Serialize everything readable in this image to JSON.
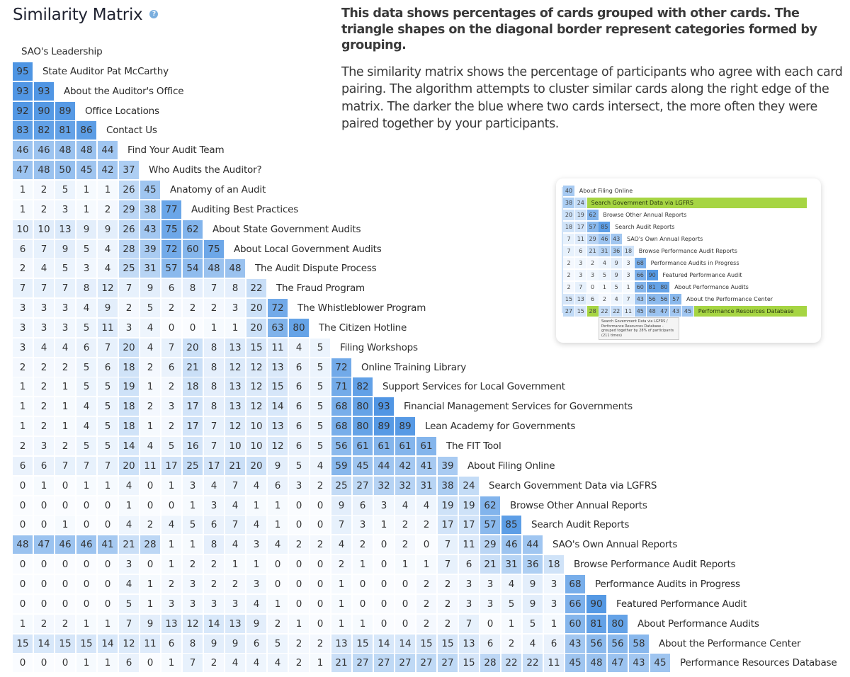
{
  "header": {
    "title": "Similarity Matrix",
    "help_icon": "question-circle-icon",
    "help_glyph": "?"
  },
  "description": {
    "lead": "This data shows percentages of cards grouped with other cards. The triangle shapes on the diagonal border represent categories formed by grouping.",
    "body": "The similarity matrix shows the percentage of participants who agree with each card pairing. The algorithm attempts to cluster similar cards along the right edge of the matrix. The darker the blue where two cards intersect, the more often they were paired together by your participants."
  },
  "colors": {
    "cell_blue_dark": "#4a90e2",
    "cell_blue_light": "#eaf3fd",
    "highlight_green": "#a6d543"
  },
  "chart_data": {
    "type": "heatmap",
    "title": "Similarity Matrix",
    "unit": "percent of participants",
    "range": [
      0,
      100
    ],
    "cards": [
      "SAO's Leadership",
      "State Auditor Pat McCarthy",
      "About the Auditor's Office",
      "Office Locations",
      "Contact Us",
      "Find Your Audit Team",
      "Who Audits the Auditor?",
      "Anatomy of an Audit",
      "Auditing Best Practices",
      "About State Government Audits",
      "About Local Government Audits",
      "The Audit Dispute Process",
      "The Fraud Program",
      "The Whistleblower Program",
      "The Citizen Hotline",
      "Filing Workshops",
      "Online Training Library",
      "Support Services for Local Government",
      "Financial Management Services for Governments",
      "Lean Academy for Governments",
      "The FIT Tool",
      "About Filing Online",
      "Search Government Data via LGFRS",
      "Browse Other Annual Reports",
      "Search Audit Reports",
      "SAO's Own Annual Reports",
      "Browse Performance Audit Reports",
      "Performance Audits in Progress",
      "Featured Performance Audit",
      "About Performance Audits",
      "About the Performance Center",
      "Performance Resources Database"
    ],
    "clusters": [
      [
        0,
        4
      ],
      [
        5,
        6
      ],
      [
        7,
        11
      ],
      [
        12,
        14
      ],
      [
        15,
        20
      ],
      [
        21,
        26
      ],
      [
        27,
        31
      ]
    ],
    "rows": [
      [],
      [
        95
      ],
      [
        93,
        93
      ],
      [
        92,
        90,
        89
      ],
      [
        83,
        82,
        81,
        86
      ],
      [
        46,
        46,
        48,
        48,
        44
      ],
      [
        47,
        48,
        50,
        45,
        42,
        37
      ],
      [
        1,
        2,
        5,
        1,
        1,
        26,
        45
      ],
      [
        1,
        2,
        3,
        1,
        2,
        29,
        38,
        77
      ],
      [
        10,
        10,
        13,
        9,
        9,
        26,
        43,
        75,
        62
      ],
      [
        6,
        7,
        9,
        5,
        4,
        28,
        39,
        72,
        60,
        75
      ],
      [
        2,
        4,
        5,
        3,
        4,
        25,
        31,
        57,
        54,
        48,
        48
      ],
      [
        7,
        7,
        7,
        8,
        12,
        7,
        9,
        6,
        8,
        7,
        8,
        22
      ],
      [
        3,
        3,
        3,
        4,
        9,
        2,
        5,
        2,
        2,
        2,
        3,
        20,
        72
      ],
      [
        3,
        3,
        3,
        5,
        11,
        3,
        4,
        0,
        0,
        1,
        1,
        20,
        63,
        80
      ],
      [
        3,
        4,
        4,
        6,
        7,
        20,
        4,
        7,
        20,
        8,
        13,
        15,
        11,
        4,
        5
      ],
      [
        2,
        2,
        2,
        5,
        6,
        18,
        2,
        6,
        21,
        8,
        12,
        12,
        13,
        6,
        5,
        72
      ],
      [
        1,
        2,
        1,
        5,
        5,
        19,
        1,
        2,
        18,
        8,
        13,
        12,
        15,
        6,
        5,
        71,
        82
      ],
      [
        1,
        2,
        1,
        4,
        5,
        18,
        2,
        3,
        17,
        8,
        13,
        12,
        14,
        6,
        5,
        68,
        80,
        93
      ],
      [
        1,
        2,
        1,
        4,
        5,
        18,
        1,
        2,
        17,
        7,
        12,
        10,
        13,
        6,
        5,
        68,
        80,
        89,
        89
      ],
      [
        2,
        3,
        2,
        5,
        5,
        14,
        4,
        5,
        16,
        7,
        10,
        10,
        12,
        6,
        5,
        56,
        61,
        61,
        61,
        61
      ],
      [
        6,
        6,
        7,
        7,
        7,
        20,
        11,
        17,
        25,
        17,
        21,
        20,
        9,
        5,
        4,
        59,
        45,
        44,
        42,
        41,
        39
      ],
      [
        0,
        1,
        0,
        1,
        1,
        4,
        0,
        1,
        3,
        4,
        7,
        4,
        6,
        3,
        2,
        25,
        27,
        32,
        32,
        31,
        38,
        24
      ],
      [
        0,
        0,
        0,
        0,
        0,
        1,
        0,
        0,
        1,
        3,
        4,
        1,
        1,
        0,
        0,
        9,
        6,
        3,
        4,
        4,
        19,
        19,
        62
      ],
      [
        0,
        0,
        1,
        0,
        0,
        4,
        2,
        4,
        5,
        6,
        7,
        4,
        1,
        0,
        0,
        7,
        3,
        1,
        2,
        2,
        17,
        17,
        57,
        85
      ],
      [
        48,
        47,
        46,
        46,
        41,
        21,
        28,
        1,
        1,
        8,
        4,
        3,
        4,
        2,
        2,
        4,
        2,
        0,
        2,
        0,
        7,
        11,
        29,
        46,
        44
      ],
      [
        0,
        0,
        0,
        0,
        0,
        3,
        0,
        1,
        2,
        2,
        1,
        1,
        0,
        0,
        0,
        2,
        1,
        0,
        1,
        1,
        7,
        6,
        21,
        31,
        36,
        18
      ],
      [
        0,
        0,
        0,
        0,
        0,
        4,
        1,
        2,
        3,
        2,
        2,
        3,
        0,
        0,
        0,
        1,
        0,
        0,
        0,
        2,
        2,
        3,
        3,
        4,
        9,
        3,
        68
      ],
      [
        0,
        0,
        0,
        0,
        0,
        5,
        1,
        3,
        3,
        3,
        3,
        4,
        1,
        0,
        0,
        1,
        0,
        0,
        0,
        2,
        2,
        3,
        3,
        5,
        9,
        3,
        66,
        90
      ],
      [
        1,
        2,
        2,
        1,
        1,
        7,
        9,
        13,
        12,
        14,
        13,
        9,
        2,
        1,
        0,
        1,
        1,
        0,
        0,
        2,
        2,
        7,
        0,
        1,
        5,
        1,
        60,
        81,
        80
      ],
      [
        15,
        14,
        15,
        15,
        14,
        12,
        11,
        6,
        8,
        9,
        9,
        6,
        5,
        2,
        2,
        13,
        15,
        14,
        14,
        15,
        15,
        13,
        6,
        2,
        4,
        6,
        43,
        56,
        56,
        58
      ],
      [
        0,
        0,
        0,
        1,
        1,
        6,
        0,
        1,
        7,
        2,
        4,
        4,
        4,
        2,
        1,
        21,
        27,
        27,
        27,
        27,
        27,
        15,
        28,
        22,
        22,
        11,
        45,
        48,
        47,
        43,
        45
      ]
    ]
  },
  "inset": {
    "rows": [
      {
        "label": "About Filing Online",
        "values": [
          40
        ],
        "highlight": false
      },
      {
        "label": "Search Government Data via LGFRS",
        "values": [
          38,
          24
        ],
        "highlight": true
      },
      {
        "label": "Browse Other Annual Reports",
        "values": [
          20,
          19,
          62
        ],
        "highlight": false
      },
      {
        "label": "Search Audit Reports",
        "values": [
          18,
          17,
          57,
          85
        ],
        "highlight": false
      },
      {
        "label": "SAO's Own Annual Reports",
        "values": [
          7,
          11,
          29,
          46,
          43
        ],
        "highlight": false
      },
      {
        "label": "Browse Performance Audit Reports",
        "values": [
          7,
          6,
          21,
          31,
          36,
          18
        ],
        "highlight": false
      },
      {
        "label": "Performance Audits in Progress",
        "values": [
          2,
          3,
          2,
          4,
          9,
          3,
          68
        ],
        "highlight": false
      },
      {
        "label": "Featured Performance Audit",
        "values": [
          2,
          3,
          3,
          5,
          9,
          3,
          66,
          90
        ],
        "highlight": false
      },
      {
        "label": "About Performance Audits",
        "values": [
          2,
          7,
          0,
          1,
          5,
          1,
          60,
          81,
          80
        ],
        "highlight": false
      },
      {
        "label": "About the Performance Center",
        "values": [
          15,
          13,
          6,
          2,
          4,
          7,
          43,
          56,
          56,
          57
        ],
        "highlight": false
      },
      {
        "label": "Performance Resources Database",
        "values": [
          27,
          15,
          28,
          22,
          22,
          11,
          45,
          48,
          47,
          43,
          45
        ],
        "highlight": true,
        "highlight_cell": 2
      }
    ],
    "tooltip": "Search Government Data via LGFRS / Performance Resources Database - grouped together by 28% of participants (211 times)"
  }
}
